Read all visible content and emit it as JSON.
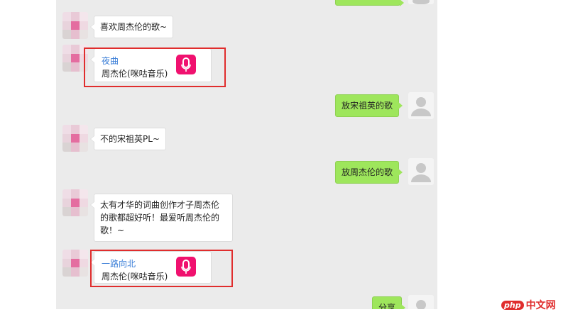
{
  "conversation": {
    "messages": [
      {
        "sender": "bot",
        "kind": "text",
        "text": "喜欢周杰伦的歌~"
      },
      {
        "sender": "bot",
        "kind": "music",
        "title": "夜曲",
        "artist": "周杰伦(咪咕音乐)",
        "icon": "microphone-icon"
      },
      {
        "sender": "user",
        "kind": "text",
        "text": "放宋祖英的歌"
      },
      {
        "sender": "bot",
        "kind": "text",
        "text": "不的宋祖英PL~"
      },
      {
        "sender": "user",
        "kind": "text",
        "text": "放周杰伦的歌"
      },
      {
        "sender": "bot",
        "kind": "text",
        "text": "太有才华的词曲创作才子周杰伦的歌都超好听！最爱听周杰伦的歌！~"
      },
      {
        "sender": "bot",
        "kind": "music",
        "title": "一路向北",
        "artist": "周杰伦(咪咕音乐)",
        "icon": "microphone-icon"
      },
      {
        "sender": "user",
        "kind": "text",
        "text": "分享"
      }
    ]
  },
  "watermark": {
    "badge": "php",
    "text": "中文网"
  },
  "colors": {
    "chat_background": "#ebebeb",
    "user_bubble": "#9ee65c",
    "bot_bubble": "#ffffff",
    "music_title": "#3b7fd8",
    "music_icon_bg": "#f0116f",
    "highlight_box": "#e02d2d"
  }
}
